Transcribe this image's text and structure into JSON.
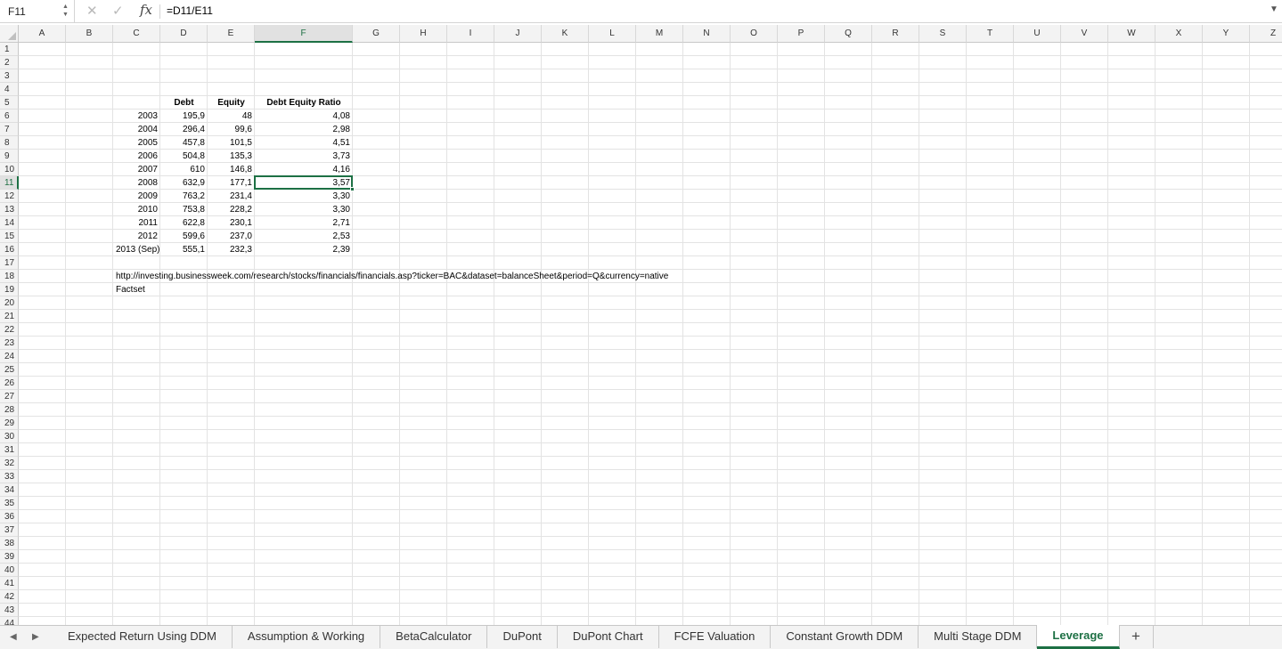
{
  "formula_bar": {
    "name_box": "F11",
    "cancel_icon": "close-icon",
    "enter_icon": "check-icon",
    "fx_label": "fx",
    "formula": "=D11/E11"
  },
  "grid": {
    "columns": [
      "A",
      "B",
      "C",
      "D",
      "E",
      "F",
      "G",
      "H",
      "I",
      "J",
      "K",
      "L",
      "M",
      "N",
      "O",
      "P",
      "Q",
      "R",
      "S",
      "T",
      "U",
      "V",
      "W",
      "X",
      "Y",
      "Z"
    ],
    "selected_column": "F",
    "selected_row": "11",
    "rows": [
      "1",
      "2",
      "3",
      "4",
      "5",
      "6",
      "7",
      "8",
      "9",
      "10",
      "11",
      "12",
      "13",
      "14",
      "15",
      "16",
      "17",
      "18",
      "19",
      "20",
      "21",
      "22",
      "23",
      "24",
      "25",
      "26",
      "27",
      "28",
      "29",
      "30",
      "31",
      "32",
      "33",
      "34",
      "35",
      "36",
      "37",
      "38",
      "39",
      "40",
      "41",
      "42",
      "43",
      "44"
    ],
    "headers": {
      "debt": "Debt",
      "equity": "Equity",
      "ratio": "Debt Equity Ratio"
    },
    "table": [
      {
        "year": "2003",
        "debt": "195,9",
        "equity": "48",
        "ratio": "4,08"
      },
      {
        "year": "2004",
        "debt": "296,4",
        "equity": "99,6",
        "ratio": "2,98"
      },
      {
        "year": "2005",
        "debt": "457,8",
        "equity": "101,5",
        "ratio": "4,51"
      },
      {
        "year": "2006",
        "debt": "504,8",
        "equity": "135,3",
        "ratio": "3,73"
      },
      {
        "year": "2007",
        "debt": "610",
        "equity": "146,8",
        "ratio": "4,16"
      },
      {
        "year": "2008",
        "debt": "632,9",
        "equity": "177,1",
        "ratio": "3,57"
      },
      {
        "year": "2009",
        "debt": "763,2",
        "equity": "231,4",
        "ratio": "3,30"
      },
      {
        "year": "2010",
        "debt": "753,8",
        "equity": "228,2",
        "ratio": "3,30"
      },
      {
        "year": "2011",
        "debt": "622,8",
        "equity": "230,1",
        "ratio": "2,71"
      },
      {
        "year": "2012",
        "debt": "599,6",
        "equity": "237,0",
        "ratio": "2,53"
      },
      {
        "year": "2013 (Sep)",
        "debt": "555,1",
        "equity": "232,3",
        "ratio": "2,39"
      }
    ],
    "source_url": "http://investing.businessweek.com/research/stocks/financials/financials.asp?ticker=BAC&dataset=balanceSheet&period=Q&currency=native",
    "source_note": "Factset"
  },
  "sheet_tabs": {
    "tabs": [
      "Expected Return Using DDM",
      "Assumption & Working",
      "BetaCalculator",
      "DuPont",
      "DuPont Chart",
      "FCFE Valuation",
      "Constant Growth DDM",
      "Multi Stage DDM",
      "Leverage"
    ],
    "active": "Leverage",
    "add_label": "+"
  },
  "colors": {
    "accent": "#1d7044",
    "gridline": "#e3e3e3",
    "header_bg": "#f3f3f3"
  }
}
